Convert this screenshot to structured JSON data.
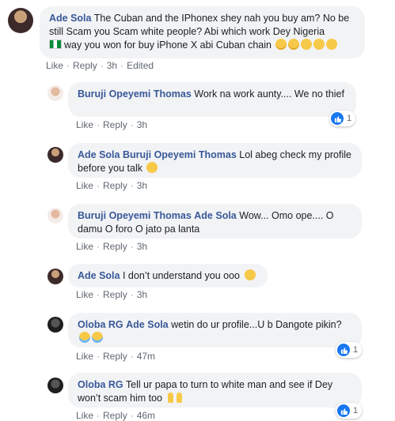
{
  "comments": [
    {
      "author": "Ade Sola",
      "text_part1": "The Cuban and the IPhonex shey nah you buy am? No be still Scam you Scam white people? Abi which work Dey Nigeria",
      "text_part2": "way you won for buy iPhone X abi Cuban chain",
      "like": "Like",
      "reply": "Reply",
      "time": "3h",
      "edited": "Edited"
    },
    {
      "author": "Buruji Opeyemi Thomas",
      "text": "Work na work aunty.... We no thief",
      "like": "Like",
      "reply": "Reply",
      "time": "3h",
      "reaction_count": "1"
    },
    {
      "author": "Ade Sola",
      "mention": "Buruji Opeyemi Thomas",
      "text": "Lol abeg check my profile before you talk",
      "like": "Like",
      "reply": "Reply",
      "time": "3h"
    },
    {
      "author": "Buruji Opeyemi Thomas",
      "mention": "Ade Sola",
      "text": "Wow... Omo ope.... O damu O foro O jato pa lanta",
      "like": "Like",
      "reply": "Reply",
      "time": "3h"
    },
    {
      "author": "Ade Sola",
      "text": "I don’t understand you ooo",
      "like": "Like",
      "reply": "Reply",
      "time": "3h"
    },
    {
      "author": "Oloba RG",
      "mention": "Ade Sola",
      "text": "wetin do ur profile...U b Dangote pikin?",
      "like": "Like",
      "reply": "Reply",
      "time": "47m",
      "reaction_count": "1"
    },
    {
      "author": "Oloba RG",
      "text": "Tell ur papa to turn to white man and see if Dey won’t scam him too",
      "like": "Like",
      "reply": "Reply",
      "time": "46m",
      "reaction_count": "1"
    }
  ],
  "colors": {
    "bubble": "#f2f3f5",
    "name": "#385898",
    "meta": "#606770",
    "like_badge": "#1877f2"
  },
  "icons": [
    "flag-icon",
    "smirk-emoji-icon",
    "think-emoji-icon",
    "hug-emoji-icon",
    "joy-emoji-icon",
    "thumbs-up-emoji-icon",
    "like-reaction-icon"
  ]
}
